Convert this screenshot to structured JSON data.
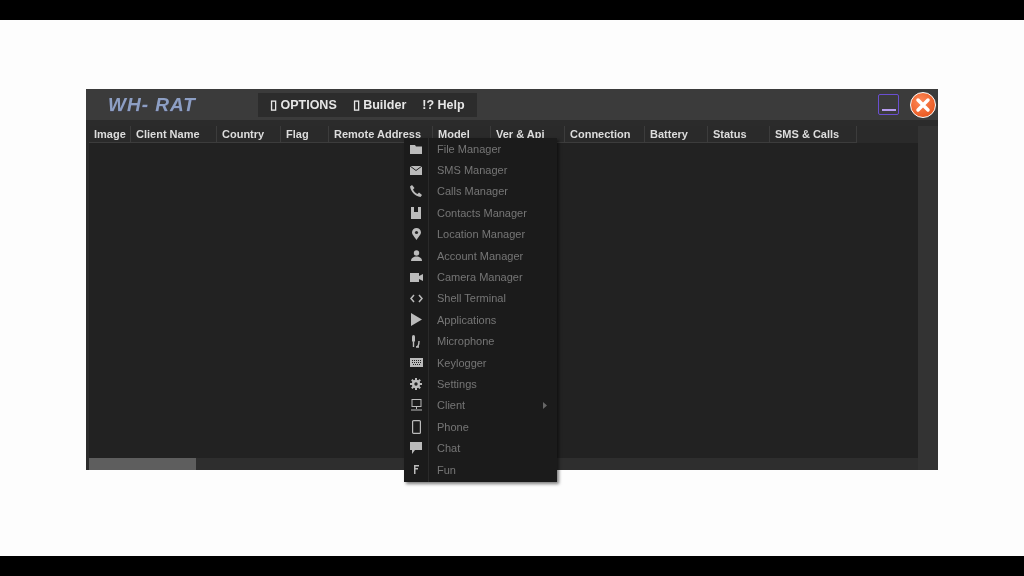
{
  "window": {
    "logo": "WH- RAT"
  },
  "menu": [
    {
      "icon": "▯",
      "label": "OPTIONS"
    },
    {
      "icon": "▯",
      "label": "Builder"
    },
    {
      "icon": "!?",
      "label": "Help"
    }
  ],
  "table": {
    "columns": [
      "Image",
      "Client Name",
      "Country",
      "Flag",
      "Remote Address",
      "Model",
      "Ver & Api",
      "Connection",
      "Battery",
      "Status",
      "SMS & Calls"
    ]
  },
  "context_menu": [
    {
      "label": "File Manager",
      "submenu": false
    },
    {
      "label": "SMS Manager",
      "submenu": false
    },
    {
      "label": "Calls Manager",
      "submenu": false
    },
    {
      "label": "Contacts Manager",
      "submenu": false
    },
    {
      "label": "Location Manager",
      "submenu": false
    },
    {
      "label": "Account Manager",
      "submenu": false
    },
    {
      "label": "Camera Manager",
      "submenu": false
    },
    {
      "label": "Shell Terminal",
      "submenu": false
    },
    {
      "label": "Applications",
      "submenu": false
    },
    {
      "label": "Microphone",
      "submenu": false
    },
    {
      "label": "Keylogger",
      "submenu": false
    },
    {
      "label": "Settings",
      "submenu": false
    },
    {
      "label": "Client",
      "submenu": true
    },
    {
      "label": "Phone",
      "submenu": false
    },
    {
      "label": "Chat",
      "submenu": false
    },
    {
      "label": "Fun",
      "submenu": false
    }
  ]
}
